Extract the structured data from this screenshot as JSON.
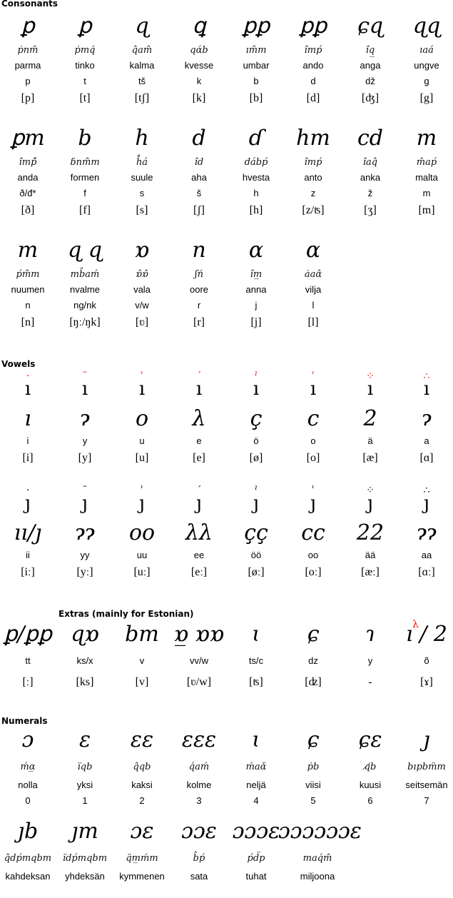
{
  "colors": {
    "tehta_highlight": "#ff0000",
    "text": "#000000",
    "background": "#ffffff"
  },
  "consonants": {
    "title": "Consonants",
    "rows": [
      [
        {
          "glyph": "tengwa-parma",
          "shape": "ꝑ",
          "trans": "ṗnm̂",
          "name": "parma",
          "latin": "p",
          "ipa": "[p]"
        },
        {
          "glyph": "tengwa-tinko",
          "shape": "ꝑ",
          "trans": "ṗmq́",
          "name": "tinko",
          "latin": "t",
          "ipa": "[t]"
        },
        {
          "glyph": "tengwa-kalma",
          "shape": "ɋ",
          "trans": "q̂am̂",
          "name": "kalma",
          "latin": "tš",
          "ipa": "[tʃ]"
        },
        {
          "glyph": "tengwa-kvesse",
          "shape": "ꝗ",
          "trans": "qɑ́b",
          "name": "kvesse",
          "latin": "k",
          "ipa": "[k]"
        },
        {
          "glyph": "tengwa-umbar",
          "shape": "ꝑꝑ",
          "trans": "ım̂m",
          "name": "umbar",
          "latin": "b",
          "ipa": "[b]"
        },
        {
          "glyph": "tengwa-ando",
          "shape": "ꝑꝑ",
          "trans": "îmṕ",
          "name": "ando",
          "latin": "d",
          "ipa": "[d]"
        },
        {
          "glyph": "tengwa-anga",
          "shape": "ɕɋ",
          "trans": "îq̲",
          "name": "anga",
          "latin": "dž",
          "ipa": "[ʤ]"
        },
        {
          "glyph": "tengwa-ungwe",
          "shape": "ɋɋ",
          "trans": "ıaá",
          "name": "ungve",
          "latin": "g",
          "ipa": "[g]"
        }
      ],
      [
        {
          "glyph": "tengwa-anda",
          "shape": "ꝑm",
          "trans": "îmṕ̂",
          "name": "anda",
          "latin": "ð/đ*",
          "ipa": "[ð]"
        },
        {
          "glyph": "tengwa-formen",
          "shape": "b",
          "trans": "ɓnm̂m",
          "name": "formen",
          "latin": "f",
          "ipa": "[f]"
        },
        {
          "glyph": "tengwa-suule",
          "shape": "h",
          "trans": "h̊á",
          "name": "suule",
          "latin": "s",
          "ipa": "[s]"
        },
        {
          "glyph": "tengwa-aha",
          "shape": "d",
          "trans": "îd",
          "name": "aha",
          "latin": "š",
          "ipa": "[ʃ]"
        },
        {
          "glyph": "tengwa-hwesta",
          "shape": "ɗ",
          "trans": "dábṕ",
          "name": "hvesta",
          "latin": "h",
          "ipa": "[h]"
        },
        {
          "glyph": "tengwa-anto",
          "shape": "hm",
          "trans": "îmṕ",
          "name": "anto",
          "latin": "z",
          "ipa": "[z/ʦ]"
        },
        {
          "glyph": "tengwa-anca",
          "shape": "cd",
          "trans": "îaq̂",
          "name": "anka",
          "latin": "ž",
          "ipa": "[ʒ]"
        },
        {
          "glyph": "tengwa-malta",
          "shape": "m",
          "trans": "m̂aṕ",
          "name": "malta",
          "latin": "m",
          "ipa": "[m]"
        }
      ],
      [
        {
          "glyph": "tengwa-noldo",
          "shape": "m",
          "trans": "ṕm̂m",
          "name": "nuumen",
          "latin": "n",
          "ipa": "[n]"
        },
        {
          "glyph": "tengwa-nwalme",
          "shape": "ɋ ɋ",
          "trans": "mb̂aḿ",
          "name": "nvalme",
          "latin": "ng/nk",
          "ipa": "[ŋː/ŋk]"
        },
        {
          "glyph": "tengwa-vala",
          "shape": "ɒ",
          "trans": "ɒ̂ɒ̂",
          "name": "vala",
          "latin": "v/w",
          "ipa": "[ʋ]"
        },
        {
          "glyph": "tengwa-oore",
          "shape": "n",
          "trans": "ʃń",
          "name": "oore",
          "latin": "r",
          "ipa": "[r]"
        },
        {
          "glyph": "tengwa-anna",
          "shape": "ɑ",
          "trans": "îm̲",
          "name": "anna",
          "latin": "j",
          "ipa": "[j]"
        },
        {
          "glyph": "tengwa-vilya",
          "shape": "ɑ",
          "trans": "ȧaɑ̂",
          "name": "vilja",
          "latin": "l",
          "ipa": "[l]"
        }
      ]
    ]
  },
  "vowels": {
    "title": "Vowels",
    "short": [
      {
        "tehta": "·",
        "tehta_name": "dot",
        "carrier": "ı",
        "alt": "ı",
        "name": "i",
        "ipa": "[i]"
      },
      {
        "tehta": "¨",
        "tehta_name": "double-dot",
        "carrier": "ı",
        "alt": "ɂ",
        "name": "y",
        "ipa": "[y]"
      },
      {
        "tehta": "ʾ",
        "tehta_name": "right-curl",
        "carrier": "ı",
        "alt": "o",
        "name": "u",
        "ipa": "[u]"
      },
      {
        "tehta": "´",
        "tehta_name": "acute",
        "carrier": "ı",
        "alt": "λ",
        "name": "e",
        "ipa": "[e]"
      },
      {
        "tehta": "ˀ",
        "tehta_name": "left-curl",
        "carrier": "ı",
        "alt": "ç",
        "name": "ö",
        "ipa": "[ø]"
      },
      {
        "tehta": "ʿ",
        "tehta_name": "hook",
        "carrier": "ı",
        "alt": "c",
        "name": "o",
        "ipa": "[o]"
      },
      {
        "tehta": "⁘",
        "tehta_name": "three-dots-inverted",
        "carrier": "ı",
        "alt": "2",
        "name": "ä",
        "ipa": "[æ]"
      },
      {
        "tehta": "∴",
        "tehta_name": "three-dots",
        "carrier": "ı",
        "alt": "ɂ",
        "name": "a",
        "ipa": "[ɑ]"
      }
    ],
    "long": [
      {
        "tehta": "·",
        "carrier": "ȷ",
        "alt": "ıı/ȷ",
        "name": "ii",
        "ipa": "[iː]"
      },
      {
        "tehta": "¨",
        "carrier": "ȷ",
        "alt": "ɂɂ",
        "name": "yy",
        "ipa": "[yː]"
      },
      {
        "tehta": "ʾ",
        "carrier": "ȷ",
        "alt": "oo",
        "name": "uu",
        "ipa": "[uː]"
      },
      {
        "tehta": "´",
        "carrier": "ȷ",
        "alt": "λλ",
        "name": "ee",
        "ipa": "[eː]"
      },
      {
        "tehta": "ˀ",
        "carrier": "ȷ",
        "alt": "çç",
        "name": "öö",
        "ipa": "[øː]"
      },
      {
        "tehta": "ʿ",
        "carrier": "ȷ",
        "alt": "cc",
        "name": "oo",
        "ipa": "[oː]"
      },
      {
        "tehta": "⁘",
        "carrier": "ȷ",
        "alt": "22",
        "name": "ää",
        "ipa": "[æː]"
      },
      {
        "tehta": "∴",
        "carrier": "ȷ",
        "alt": "ɂɂ",
        "name": "aa",
        "ipa": "[ɑː]"
      }
    ]
  },
  "extras": {
    "title": "Extras (mainly for Estonian)",
    "items": [
      {
        "glyph": "doubling-bar",
        "shape": "ꝑ/ꝑꝑ",
        "name": "tt",
        "ipa": "[ː]"
      },
      {
        "glyph": "tengwa-ks",
        "shape": "ɋɒ",
        "name": "ks/x",
        "ipa": "[ks]"
      },
      {
        "glyph": "tengwa-v",
        "shape": "bm",
        "name": "v",
        "ipa": "[v]"
      },
      {
        "glyph": "tengwa-vv-w",
        "shape": "ɒ̲ ɒɒ",
        "name": "vv/w",
        "ipa": "[ʋ/w]"
      },
      {
        "glyph": "tengwa-ts",
        "shape": "ɩ",
        "name": "ts/c",
        "ipa": "[ʦ]"
      },
      {
        "glyph": "tengwa-dz",
        "shape": "ɕ",
        "name": "dz",
        "ipa": "[ʣ]"
      },
      {
        "glyph": "tengwa-y",
        "shape": "ɿ",
        "name": "y",
        "ipa": "-"
      },
      {
        "glyph": "tengwa-otilde",
        "tehta": "λ",
        "shape": "ı / 2",
        "name": "õ",
        "ipa": "[ɤ]"
      }
    ]
  },
  "numerals": {
    "title": "Numerals",
    "rows": [
      [
        {
          "glyph": "numeral-0",
          "shape": "ɔ",
          "trans": "ḿɑ̲",
          "name": "nolla",
          "value": "0"
        },
        {
          "glyph": "numeral-1",
          "shape": "ɛ",
          "trans": "ïqb",
          "name": "yksi",
          "value": "1"
        },
        {
          "glyph": "numeral-2",
          "shape": "ɛɛ",
          "trans": "q̂qb",
          "name": "kaksi",
          "value": "2"
        },
        {
          "glyph": "numeral-3",
          "shape": "ɛɛɛ",
          "trans": "q́aḿ",
          "name": "kolme",
          "value": "3"
        },
        {
          "glyph": "numeral-4",
          "shape": "ɩ",
          "trans": "ḿaɑ̌",
          "name": "neljä",
          "value": "4"
        },
        {
          "glyph": "numeral-5",
          "shape": "ɕ",
          "trans": "ṗb",
          "name": "viisi",
          "value": "5"
        },
        {
          "glyph": "numeral-6",
          "shape": "ɕɛ",
          "trans": "q̸b",
          "name": "kuusi",
          "value": "6"
        },
        {
          "glyph": "numeral-7",
          "shape": "ȷ",
          "trans": "bıpbm̈m",
          "name": "seitsemän",
          "value": "7"
        }
      ],
      [
        {
          "glyph": "numeral-8",
          "shape": "ȷb",
          "trans": "q̂dṕmqbm",
          "name": "kahdeksan",
          "value": ""
        },
        {
          "glyph": "numeral-9",
          "shape": "ȷm",
          "trans": "ïdṕmqbm",
          "name": "yhdeksän",
          "value": ""
        },
        {
          "glyph": "numeral-10",
          "shape": "ɔɛ",
          "trans": "q̈m̲ḿm",
          "name": "kymmenen",
          "value": ""
        },
        {
          "glyph": "numeral-100",
          "shape": "ɔɔɛ",
          "trans": "b̂ṕ",
          "name": "sata",
          "value": ""
        },
        {
          "glyph": "numeral-1000",
          "shape": "ɔɔɔɛ",
          "trans": "ṕd̈p",
          "name": "tuhat",
          "value": ""
        },
        {
          "glyph": "numeral-million",
          "shape": "ɔɔɔɔɔɔɛ",
          "trans": "maq́m̂",
          "name": "miljoona",
          "value": ""
        }
      ]
    ]
  }
}
